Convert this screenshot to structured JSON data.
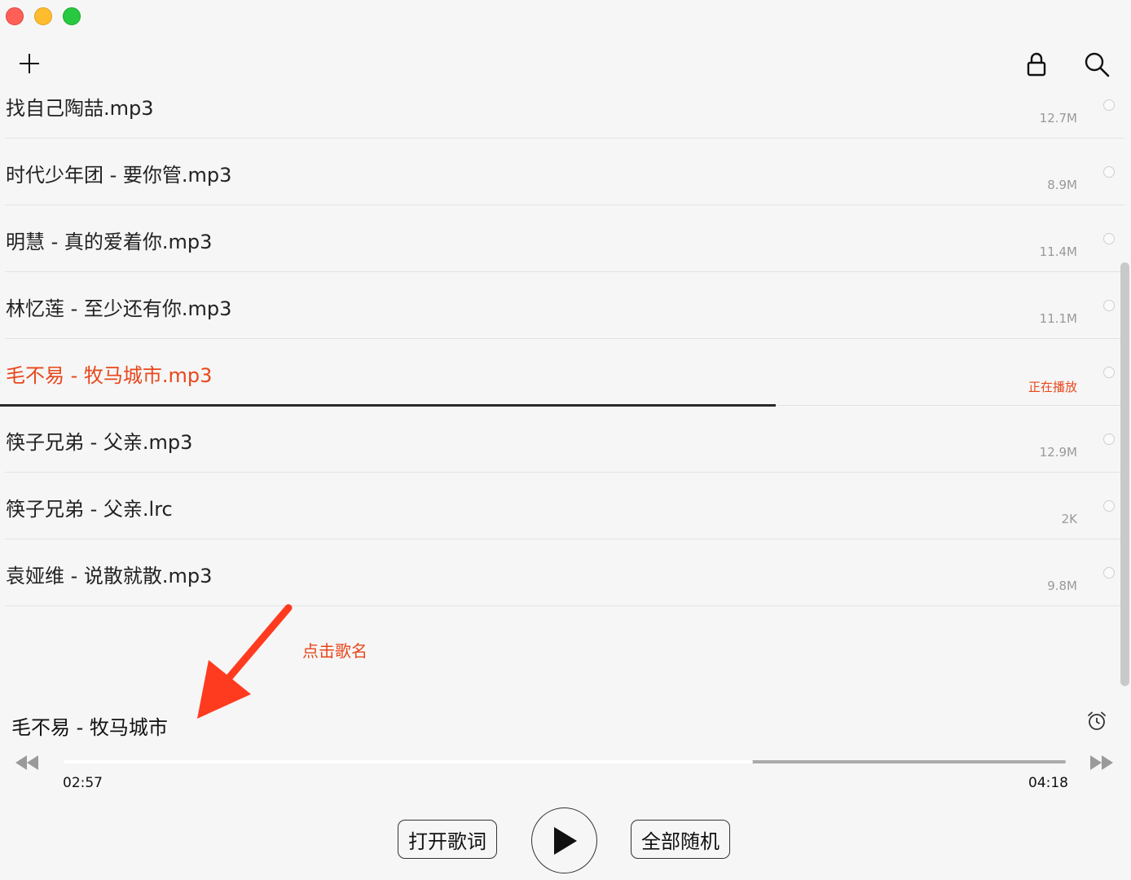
{
  "window": {
    "controls": [
      "close",
      "minimize",
      "zoom"
    ]
  },
  "toolbar": {
    "add_icon": "plus-icon",
    "lock_icon": "lock-icon",
    "search_icon": "search-icon"
  },
  "playlist": {
    "items": [
      {
        "name": "找自己陶喆.mp3",
        "size": "12.7M",
        "playing": false
      },
      {
        "name": "时代少年团 - 要你管.mp3",
        "size": "8.9M",
        "playing": false
      },
      {
        "name": "明慧 - 真的爱着你.mp3",
        "size": "11.4M",
        "playing": false
      },
      {
        "name": "林忆莲 - 至少还有你.mp3",
        "size": "11.1M",
        "playing": false
      },
      {
        "name": "毛不易 - 牧马城市.mp3",
        "size": "正在播放",
        "playing": true
      },
      {
        "name": "筷子兄弟 - 父亲.mp3",
        "size": "12.9M",
        "playing": false
      },
      {
        "name": "筷子兄弟 - 父亲.lrc",
        "size": "2K",
        "playing": false
      },
      {
        "name": "袁娅维 - 说散就散.mp3",
        "size": "9.8M",
        "playing": false
      }
    ]
  },
  "annotation": {
    "text": "点击歌名",
    "color": "#e8471c"
  },
  "player": {
    "title": "毛不易 - 牧马城市",
    "elapsed": "02:57",
    "total": "04:18",
    "progress": 0.688,
    "row_progress": 0.686,
    "lyrics_label": "打开歌词",
    "shuffle_label": "全部随机",
    "alarm_icon": "alarm-clock-icon",
    "prev_icon": "rewind-icon",
    "next_icon": "fast-forward-icon",
    "play_icon": "play-icon"
  },
  "colors": {
    "accent": "#e8471c",
    "background": "#f6f6f6"
  }
}
